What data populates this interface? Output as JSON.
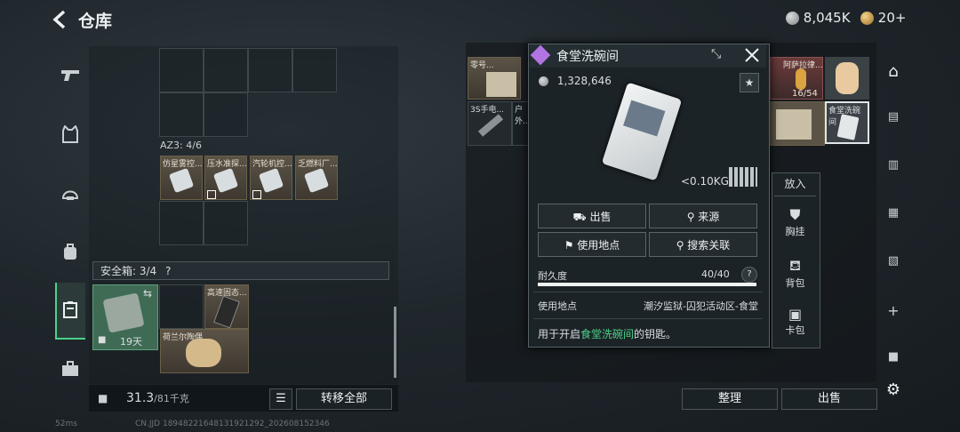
{
  "header": {
    "title": "仓库",
    "silver": "8,045K",
    "gold": "20+"
  },
  "nav": {
    "items": [
      "pistol-icon",
      "vest-icon",
      "helmet-icon",
      "backpack-icon",
      "case-icon",
      "briefcase-icon"
    ]
  },
  "left_panel": {
    "az3_label": "AZ3: 4/6",
    "az3_items": [
      "仿星雾控...",
      "压水准探...",
      "汽轮机控...",
      "乏燃料厂..."
    ],
    "safe_label": "安全箱: 3/4",
    "safe_items": {
      "timer": "19天",
      "item2_label": "高速固态...",
      "item3_label": "荷兰尔陶偶"
    },
    "weight_value": "31.3",
    "weight_max": "/81千克",
    "transfer_all": "转移全部"
  },
  "right_panel": {
    "cells": [
      "零号...",
      "阿萨拉律...",
      "3S手电...",
      "户外...",
      "食堂洗碗间"
    ],
    "count_badge": "16/54",
    "organize": "整理",
    "sell": "出售"
  },
  "popup": {
    "title": "食堂洗碗间",
    "price": "1,328,646",
    "weight": "<0.10KG",
    "btn_sell": "出售",
    "btn_source": "来源",
    "btn_location": "使用地点",
    "btn_search": "搜索关联",
    "durability_label": "耐久度",
    "durability_value": "40/40",
    "durability_fraction": 1.0,
    "use_label": "使用地点",
    "use_value": "潮汐监狱-囚犯活动区-食堂",
    "desc_prefix": "用于开启",
    "desc_highlight": "食堂洗碗间",
    "desc_suffix": "的钥匙。",
    "highlight_color": "#4cd18a"
  },
  "put_in": {
    "title": "放入",
    "items": [
      "胸挂",
      "背包",
      "卡包"
    ]
  },
  "status": {
    "ping": "52ms",
    "build": "CN.JJD 18948221648131921292_202608152346"
  }
}
